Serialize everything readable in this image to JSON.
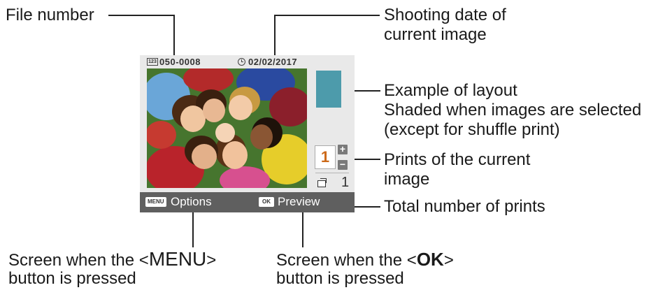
{
  "callouts": {
    "file_number": "File number",
    "shooting_date": [
      "Shooting date of",
      "current image"
    ],
    "layout_example": [
      "Example of layout",
      "Shaded when images are selected",
      "(except for shuffle print)"
    ],
    "prints_current": [
      "Prints of the current",
      "image"
    ],
    "total_prints": "Total number of prints",
    "menu_screen": {
      "prefix": "Screen when the <",
      "key": "MENU",
      "suffix": ">",
      "line2": "button is pressed"
    },
    "ok_screen": {
      "prefix": "Screen when the <",
      "key": "OK",
      "suffix": ">",
      "line2": "button is pressed"
    }
  },
  "screen": {
    "file_badge": "123",
    "file_number": "050-0008",
    "shooting_date": "02/02/2017",
    "copies": "1",
    "plus": "+",
    "minus": "−",
    "total_prints": "1",
    "menu_badge": "MENU",
    "options_label": "Options",
    "ok_badge": "OK",
    "preview_label": "Preview",
    "layout_color": "#4d9bab",
    "copies_color": "#cc6a1a"
  }
}
